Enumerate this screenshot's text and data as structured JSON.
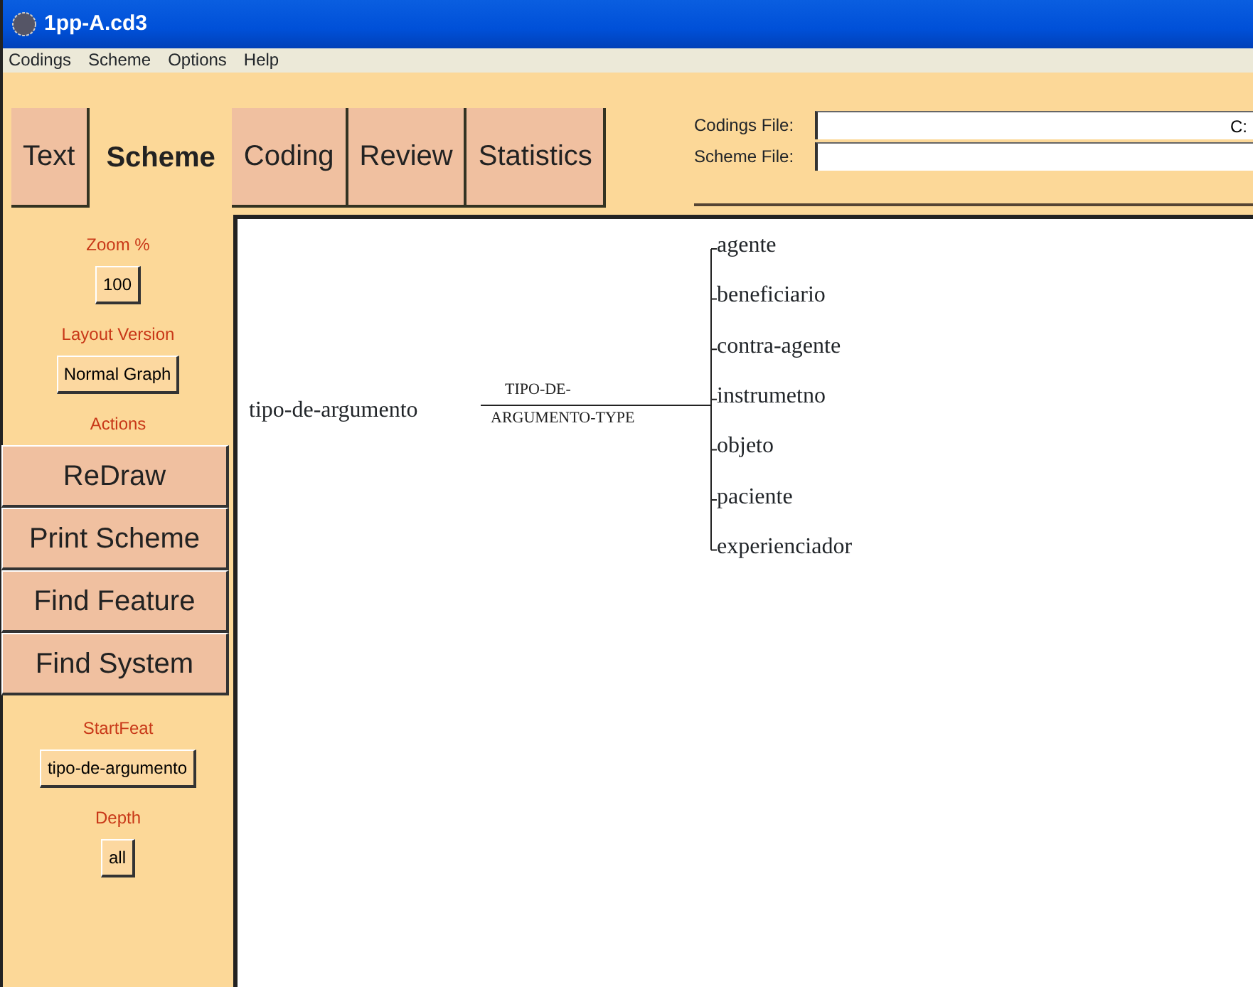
{
  "window": {
    "title": "1pp-A.cd3"
  },
  "menu": [
    "Codings",
    "Scheme",
    "Options",
    "Help"
  ],
  "tabs": [
    {
      "label": "Text",
      "selected": false
    },
    {
      "label": "Scheme",
      "selected": true
    },
    {
      "label": "Coding",
      "selected": false
    },
    {
      "label": "Review",
      "selected": false
    },
    {
      "label": "Statistics",
      "selected": false
    }
  ],
  "file_fields": [
    {
      "label": "Codings File:",
      "value": "C:"
    },
    {
      "label": "Scheme File:"
    }
  ],
  "sidebar": [
    {
      "kind": "label",
      "text": "Zoom %"
    },
    {
      "kind": "button",
      "text": "100"
    },
    {
      "kind": "label",
      "text": "Layout Version"
    },
    {
      "kind": "button",
      "text": "Normal Graph"
    },
    {
      "kind": "label",
      "text": "Actions"
    },
    {
      "kind": "action",
      "text": "ReDraw"
    },
    {
      "kind": "action",
      "text": "Print Scheme"
    },
    {
      "kind": "action",
      "text": "Find Feature"
    },
    {
      "kind": "action",
      "text": "Find System"
    },
    {
      "kind": "label",
      "text": "StartFeat"
    },
    {
      "kind": "button",
      "text": "tipo-de-argumento"
    },
    {
      "kind": "label",
      "text": "Depth"
    },
    {
      "kind": "button",
      "text": "all"
    }
  ],
  "scheme": {
    "root": "tipo-de-argumento",
    "edge_label_lines": [
      "TIPO-DE-",
      "ARGUMENTO-TYPE"
    ],
    "children": [
      "agente",
      "beneficiario",
      "contra-agente",
      "instrumetno",
      "objeto",
      "paciente",
      "experienciador"
    ]
  }
}
